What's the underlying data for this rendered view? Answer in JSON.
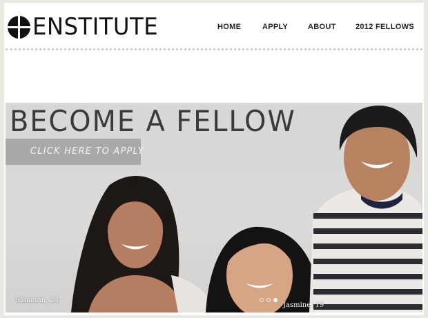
{
  "brand": {
    "name": "ENSTITUTE",
    "logo_icon": "circle-cross-logo"
  },
  "nav": [
    {
      "label": "HOME"
    },
    {
      "label": "APPLY"
    },
    {
      "label": "ABOUT"
    },
    {
      "label": "2012 FELLOWS"
    }
  ],
  "hero": {
    "title": "BECOME A FELLOW",
    "cta": "CLICK HERE TO APPLY",
    "captions": {
      "left": "Samman, 24",
      "right": "Jasmine, 19"
    },
    "slider_dots": 3,
    "active_dot": 3
  },
  "colors": {
    "text": "#111111",
    "button_bg": "#a09e9e",
    "page_bg": "#e9e8e3"
  }
}
